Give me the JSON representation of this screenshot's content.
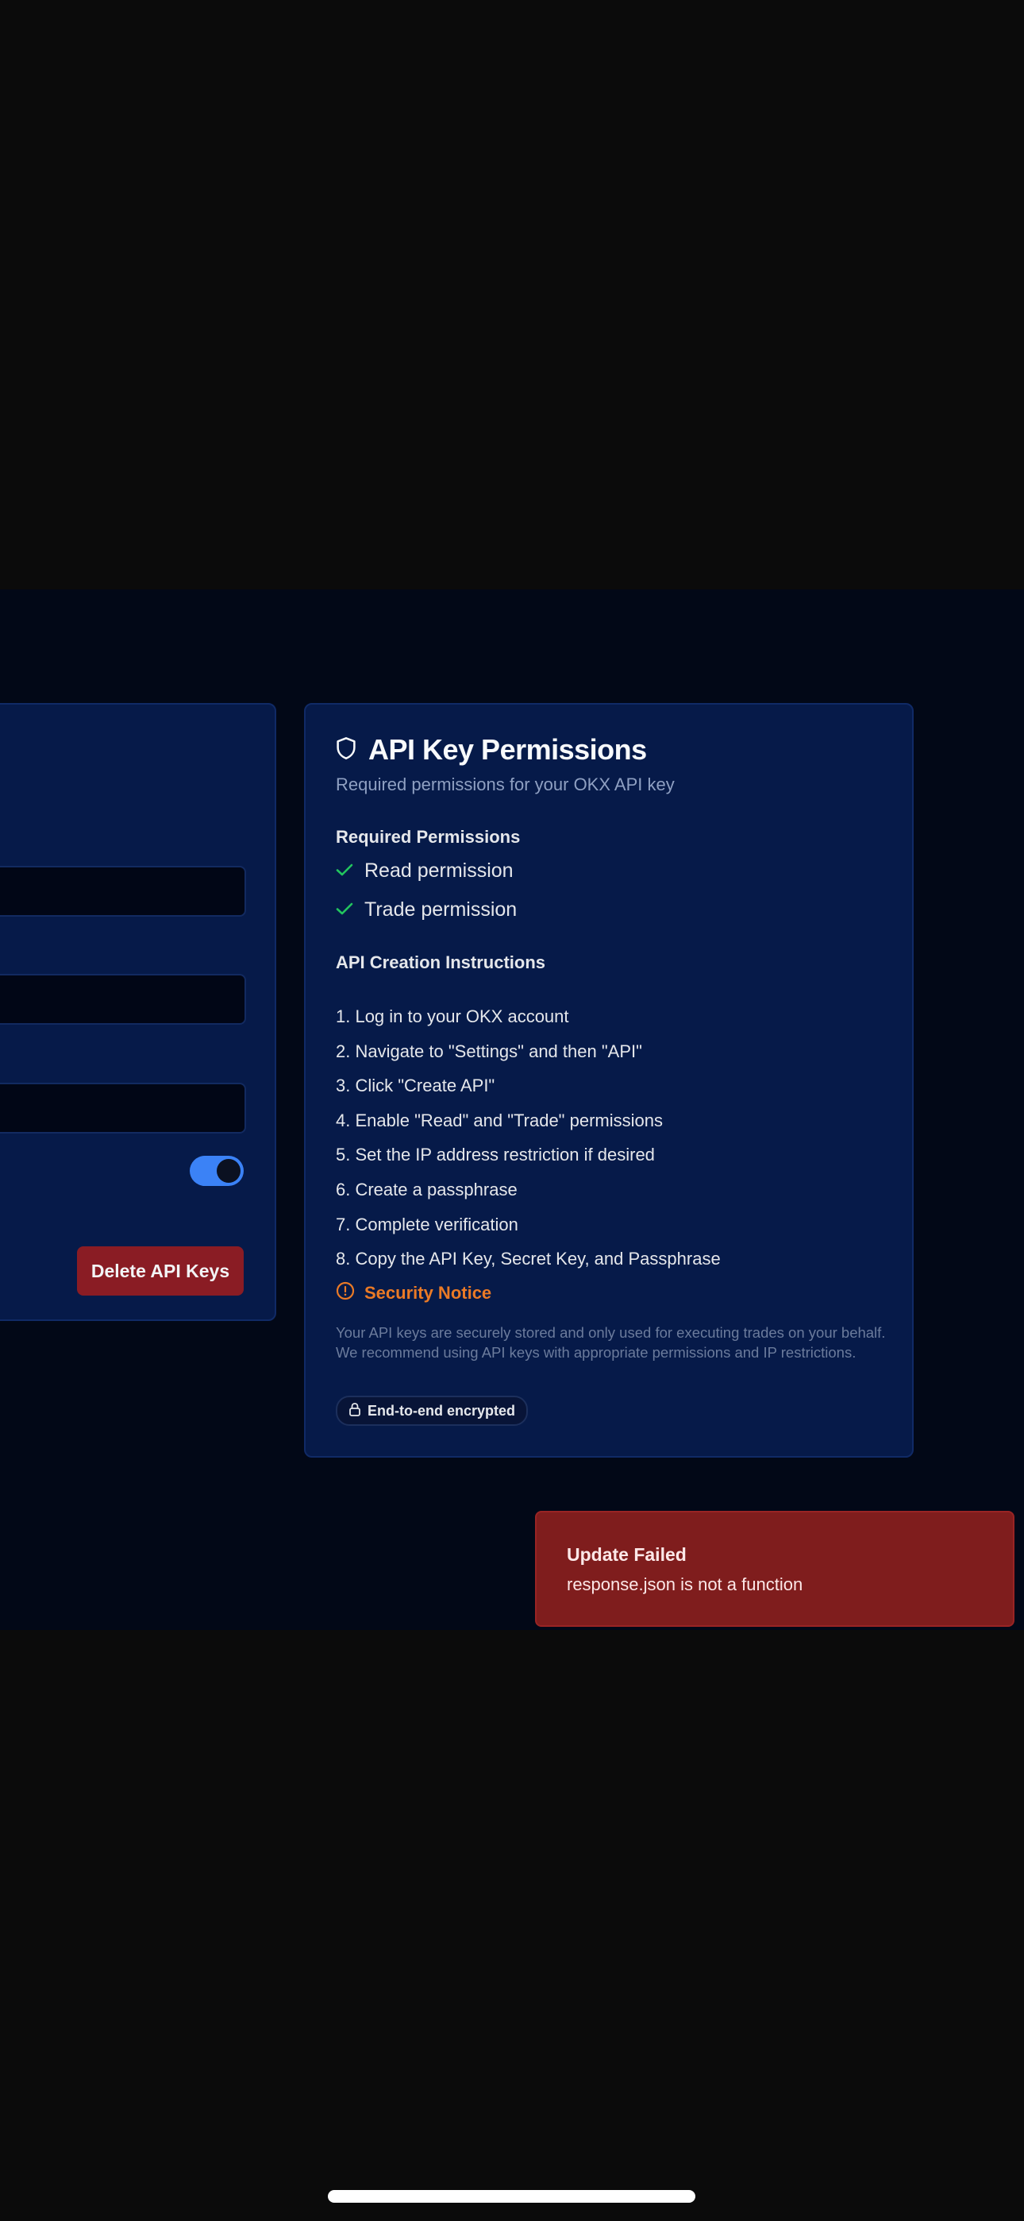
{
  "left_card": {
    "delete_button_label": "Delete API Keys"
  },
  "permissions_card": {
    "icon": "shield-icon",
    "title": "API Key Permissions",
    "subtitle": "Required permissions for your OKX API key",
    "required_heading": "Required Permissions",
    "permissions": [
      {
        "icon": "check-icon",
        "label": "Read permission"
      },
      {
        "icon": "check-icon",
        "label": "Trade permission"
      }
    ],
    "instructions_heading": "API Creation Instructions",
    "instructions": [
      "1. Log in to your OKX account",
      "2. Navigate to \"Settings\" and then \"API\"",
      "3. Click \"Create API\"",
      "4. Enable \"Read\" and \"Trade\" permissions",
      "5. Set the IP address restriction if desired",
      "6. Create a passphrase",
      "7. Complete verification",
      "8. Copy the API Key, Secret Key, and Passphrase"
    ],
    "security_notice": {
      "icon": "alert-circle-icon",
      "title": "Security Notice",
      "text": "Your API keys are securely stored and only used for executing trades on your behalf. We recommend using API keys with appropriate permissions and IP restrictions."
    },
    "badge": {
      "icon": "lock-icon",
      "label": "End-to-end encrypted"
    }
  },
  "toast": {
    "title": "Update Failed",
    "message": "response.json is not a function"
  },
  "colors": {
    "page_bg": "#0b0b0b",
    "app_bg": "#020817",
    "card_bg": "#061a49",
    "accent_blue": "#3b82f6",
    "success_green": "#22c55e",
    "warning_orange": "#ea7a26",
    "danger_red": "#8a1c24"
  }
}
